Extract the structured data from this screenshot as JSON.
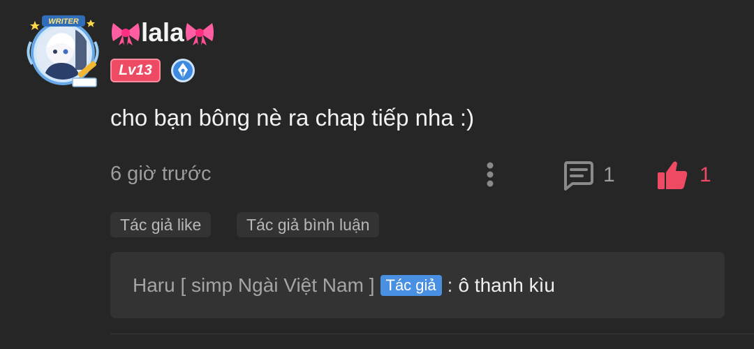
{
  "comment": {
    "username": "lala",
    "level_badge": "Lv13",
    "avatar_frame_label": "WRITER",
    "content": "cho bạn bông nè ra chap tiếp nha :)",
    "timestamp": "6 giờ trước",
    "reply_count": "1",
    "like_count": "1",
    "tags": [
      "Tác giả like",
      "Tác giả bình luận"
    ],
    "reply": {
      "author": "Haru [ simp Ngài Việt Nam ]",
      "author_badge": "Tác giả",
      "separator": ":",
      "text": "ô thanh kìu"
    }
  },
  "icons": {
    "more": "more-vertical-icon",
    "reply": "comment-icon",
    "like": "thumbs-up-icon",
    "bow": "pink-ribbon-bow-icon",
    "rank": "pen-nib-rank-icon"
  },
  "colors": {
    "background": "#262626",
    "accent": "#ef4a63",
    "author_badge": "#4a90e2",
    "muted_text": "#9d9d9d"
  }
}
